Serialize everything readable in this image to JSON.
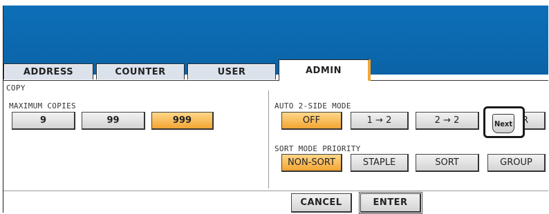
{
  "tabs": [
    "ADDRESS",
    "COUNTER",
    "USER",
    "ADMIN"
  ],
  "active_tab": "ADMIN",
  "section_title": "COPY",
  "max_copies": {
    "label": "MAXIMUM COPIES",
    "options": [
      "9",
      "99",
      "999"
    ],
    "selected": "999"
  },
  "auto2side": {
    "label": "AUTO 2-SIDE MODE",
    "options": [
      "OFF",
      "1 → 2",
      "2 → 2",
      "USER"
    ],
    "selected": "OFF"
  },
  "sort_priority": {
    "label": "SORT MODE PRIORITY",
    "options": [
      "NON-SORT",
      "STAPLE",
      "SORT",
      "GROUP"
    ],
    "selected": "NON-SORT"
  },
  "footer": {
    "cancel_label": "CANCEL",
    "enter_label": "ENTER",
    "next_label": "Next"
  },
  "colors": {
    "header": "#0d6fb8",
    "selected": "#f3a533"
  }
}
